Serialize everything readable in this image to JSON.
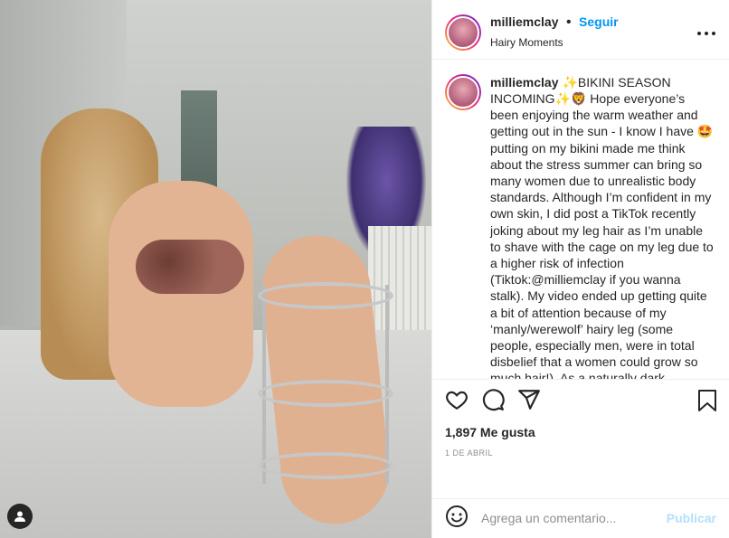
{
  "post": {
    "username": "milliemclay",
    "follow_label": "Seguir",
    "separator": "•",
    "location": "Hairy Moments",
    "more_icon": "more-horizontal-icon"
  },
  "caption": {
    "username": "milliemclay",
    "text": "✨BIKINI SEASON INCOMING✨🦁 Hope everyone’s been enjoying the warm weather and getting out in the sun - I know I have 🤩 putting on my bikini made me think about the stress summer can bring so many women due to unrealistic body standards. Although I’m confident in my own skin, I did post a TikTok recently joking about my leg hair as I’m unable to shave with the cage on my leg due to a higher risk of infection (Tiktok:@milliemclay if you wanna stalk). My video ended up getting quite a bit of attention because of my ‘manly/werewolf’ hairy leg (some people, especially men, were in total disbelief that a women could grow so much hair!). As a naturally dark"
  },
  "actions": {
    "likes": "1,897 Me gusta",
    "date": "1 DE ABRIL",
    "icons": [
      "heart-icon",
      "comment-icon",
      "share-icon",
      "bookmark-icon"
    ]
  },
  "comment": {
    "placeholder": "Agrega un comentario...",
    "publish_label": "Publicar",
    "accent": "#0095f6"
  },
  "photo": {
    "user_tag_icon": "user-tag-icon"
  }
}
